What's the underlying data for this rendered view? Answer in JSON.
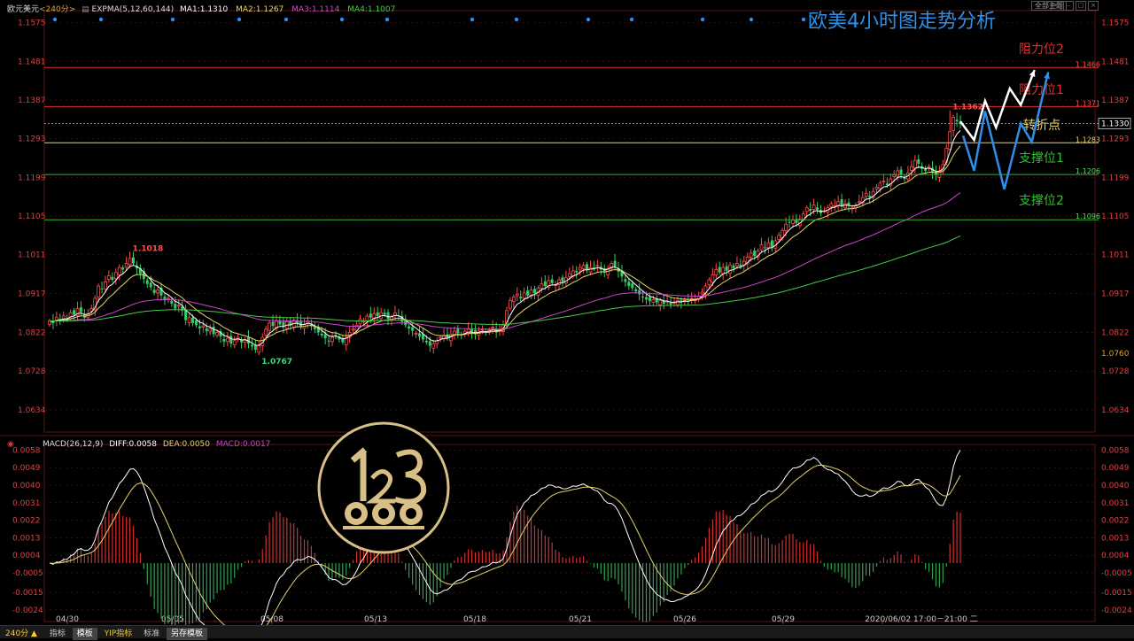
{
  "header": {
    "symbol": "欧元美元",
    "period": "<240分>",
    "indicator": "EXPMA(5,12,60,144)",
    "ma1": "MA1:1.1310",
    "ma2": "MA2:1.1267",
    "ma3": "MA3:1.1114",
    "ma4": "MA4:1.1007",
    "all_themes": "全部主题"
  },
  "overlay_title": "欧美4小时图走势分析",
  "macd_header": {
    "name": "MACD(26,12,9)",
    "diff": "DIFF:0.0058",
    "dea": "DEA:0.0050",
    "macd": "MACD:0.0017"
  },
  "toolbar": {
    "period": "240分 ▲",
    "items": [
      "指标",
      "模板",
      "YIP指标",
      "标准",
      "另存模板"
    ],
    "active_index": 1
  },
  "colors": {
    "bg": "#000000",
    "up": "#ff4a4a",
    "down": "#33cc66",
    "ma1": "#ffffff",
    "ma2": "#e6d36b",
    "ma3": "#cc44cc",
    "ma4": "#44cc44",
    "resistance": "#e03030",
    "support": "#30b030",
    "pivot": "#e6d36b",
    "dotted": "#d08030",
    "title_blue": "#2f8fe8",
    "forecast_blue": "#2f8fe8",
    "forecast_white": "#ffffff"
  },
  "chart_data": [
    {
      "type": "candlestick",
      "title": "欧美4小时图走势分析",
      "ylim": [
        1.058,
        1.16
      ],
      "y_ticks": [
        "1.1575",
        "1.1481",
        "1.1387",
        "1.1293",
        "1.1199",
        "1.1105",
        "1.1011",
        "1.0917",
        "1.0822",
        "1.0728",
        "1.0634"
      ],
      "x_ticks": [
        "04/30",
        "05/05",
        "05/08",
        "05/13",
        "05/18",
        "05/21",
        "05/26",
        "05/29",
        "2020/06/02 17:00－21:00 二"
      ],
      "horizontal_levels": [
        {
          "label": "阻力位2",
          "value": 1.1466,
          "value_label": "1.1466",
          "kind": "resistance"
        },
        {
          "label": "阻力位1",
          "value": 1.1371,
          "value_label": "1.1371",
          "kind": "resistance"
        },
        {
          "label": "转折点",
          "value": 1.1283,
          "value_label": "1.1283",
          "kind": "pivot"
        },
        {
          "label": "支撑位1",
          "value": 1.1206,
          "value_label": "1.1206",
          "kind": "support"
        },
        {
          "label": "支撑位2",
          "value": 1.1096,
          "value_label": "1.1096",
          "kind": "support"
        }
      ],
      "current_price": {
        "value": 1.133,
        "label": "1.1330"
      },
      "right_marker": "1.0760",
      "annotations": [
        {
          "text": "1.1018",
          "value": 1.1018,
          "bar": 23
        },
        {
          "text": "1.0767",
          "value": 1.0767,
          "bar": 60
        },
        {
          "text": "1.1362",
          "value": 1.1362,
          "bar": 258
        }
      ],
      "closes": [
        1.085,
        1.0845,
        1.0858,
        1.0852,
        1.0862,
        1.0855,
        1.087,
        1.0866,
        1.088,
        1.0872,
        1.0858,
        1.0868,
        1.088,
        1.0905,
        1.0935,
        1.0928,
        1.0945,
        1.096,
        1.095,
        1.0968,
        1.098,
        1.0975,
        1.099,
        1.1002,
        1.099,
        1.0978,
        1.0965,
        1.0952,
        1.094,
        1.0932,
        1.0918,
        1.0925,
        1.0912,
        1.09,
        1.0905,
        1.0892,
        1.088,
        1.0888,
        1.0875,
        1.0852,
        1.0858,
        1.0845,
        1.084,
        1.0832,
        1.0838,
        1.0825,
        1.083,
        1.0818,
        1.0822,
        1.0812,
        1.08,
        1.0808,
        1.0795,
        1.0802,
        1.081,
        1.0798,
        1.0805,
        1.0795,
        1.0788,
        1.078,
        1.079,
        1.081,
        1.083,
        1.0845,
        1.0838,
        1.085,
        1.0842,
        1.0835,
        1.0848,
        1.084,
        1.0852,
        1.0845,
        1.0835,
        1.0842,
        1.085,
        1.0838,
        1.083,
        1.0822,
        1.0815,
        1.0808,
        1.08,
        1.081,
        1.0815,
        1.0805,
        1.0798,
        1.081,
        1.0822,
        1.083,
        1.084,
        1.0855,
        1.085,
        1.0862,
        1.0858,
        1.0868,
        1.0862,
        1.087,
        1.0865,
        1.0855,
        1.086,
        1.087,
        1.0862,
        1.0848,
        1.084,
        1.0832,
        1.0826,
        1.082,
        1.0812,
        1.0805,
        1.0798,
        1.079,
        1.0795,
        1.0802,
        1.081,
        1.0815,
        1.0808,
        1.0818,
        1.0825,
        1.082,
        1.0815,
        1.0825,
        1.083,
        1.0822,
        1.0818,
        1.0825,
        1.083,
        1.0822,
        1.0828,
        1.0835,
        1.0822,
        1.083,
        1.084,
        1.0875,
        1.09,
        1.0908,
        1.0915,
        1.0905,
        1.0918,
        1.0912,
        1.0925,
        1.0918,
        1.093,
        1.094,
        1.0935,
        1.0948,
        1.0942,
        1.0938,
        1.095,
        1.0945,
        1.0955,
        1.0965,
        1.0972,
        1.0968,
        1.098,
        1.0985,
        1.0975,
        1.098,
        1.0978,
        1.0985,
        1.0975,
        1.0968,
        1.0978,
        1.099,
        1.0982,
        1.097,
        1.0958,
        1.0945,
        1.0935,
        1.093,
        1.0922,
        1.0915,
        1.0908,
        1.0902,
        1.0898,
        1.0902,
        1.0895,
        1.09,
        1.0892,
        1.0898,
        1.089,
        1.0895,
        1.09,
        1.0895,
        1.0902,
        1.0898,
        1.0905,
        1.0902,
        1.091,
        1.092,
        1.0935,
        1.095,
        1.0962,
        1.0975,
        1.0968,
        1.098,
        1.0972,
        1.0985,
        1.0978,
        1.099,
        1.0982,
        1.0995,
        1.1005,
        1.1015,
        1.1008,
        1.102,
        1.1035,
        1.1028,
        1.104,
        1.103,
        1.1045,
        1.1058,
        1.107,
        1.1085,
        1.109,
        1.1095,
        1.1088,
        1.1098,
        1.111,
        1.1125,
        1.1118,
        1.1132,
        1.112,
        1.1112,
        1.1118,
        1.1125,
        1.1135,
        1.113,
        1.114,
        1.1128,
        1.1135,
        1.113,
        1.1125,
        1.1132,
        1.114,
        1.115,
        1.116,
        1.115,
        1.1165,
        1.1175,
        1.1185,
        1.119,
        1.118,
        1.1195,
        1.1205,
        1.1215,
        1.1205,
        1.1195,
        1.121,
        1.1225,
        1.124,
        1.1232,
        1.122,
        1.1215,
        1.1225,
        1.121,
        1.1205,
        1.1215,
        1.123,
        1.127,
        1.131,
        1.1345,
        1.1335,
        1.133
      ],
      "series": [
        {
          "name": "MA1",
          "period": 5
        },
        {
          "name": "MA2",
          "period": 12
        },
        {
          "name": "MA3",
          "period": 60
        },
        {
          "name": "MA4",
          "period": 144
        }
      ],
      "forecast": {
        "white": [
          [
            1.1335,
            0
          ],
          [
            1.129,
            10
          ],
          [
            1.1385,
            18
          ],
          [
            1.132,
            26
          ],
          [
            1.1415,
            36
          ],
          [
            1.1375,
            44
          ],
          [
            1.146,
            54
          ]
        ],
        "blue": [
          [
            1.13,
            2
          ],
          [
            1.1215,
            10
          ],
          [
            1.136,
            18
          ],
          [
            1.117,
            32
          ],
          [
            1.133,
            44
          ],
          [
            1.1285,
            52
          ],
          [
            1.1455,
            64
          ]
        ]
      }
    },
    {
      "type": "bar+line",
      "title": "MACD(26,12,9)",
      "ylim": [
        -0.003,
        0.006
      ],
      "y_ticks": [
        "0.0058",
        "0.0049",
        "0.0040",
        "0.0031",
        "0.0022",
        "0.0013",
        "0.0004",
        "-0.0005",
        "-0.0015",
        "-0.0024"
      ],
      "series": [
        {
          "name": "DIFF"
        },
        {
          "name": "DEA"
        },
        {
          "name": "MACD"
        }
      ]
    }
  ]
}
